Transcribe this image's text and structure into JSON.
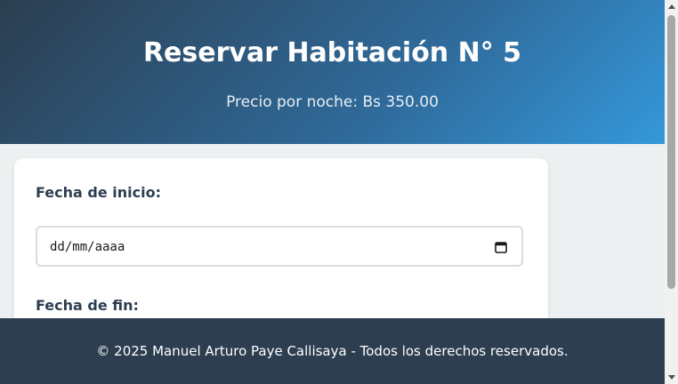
{
  "header": {
    "title": "Reservar Habitación N° 5",
    "price_line": "Precio por noche: Bs 350.00"
  },
  "form": {
    "start_label": "Fecha de inicio:",
    "start_value": "dd/mm/aaaa",
    "end_label": "Fecha de fin:"
  },
  "footer": {
    "text": "© 2025 Manuel Arturo Paye Callisaya - Todos los derechos reservados."
  },
  "icons": {
    "date_picker": "calendar-icon",
    "scroll_up": "scroll-up-arrow-icon",
    "scroll_down": "scroll-down-arrow-icon"
  },
  "colors": {
    "header_gradient_start": "#2c3e50",
    "header_gradient_end": "#3498db",
    "page_background": "#ecf0f1",
    "footer_background": "#2c3e50",
    "text_dark": "#2c3e50"
  }
}
